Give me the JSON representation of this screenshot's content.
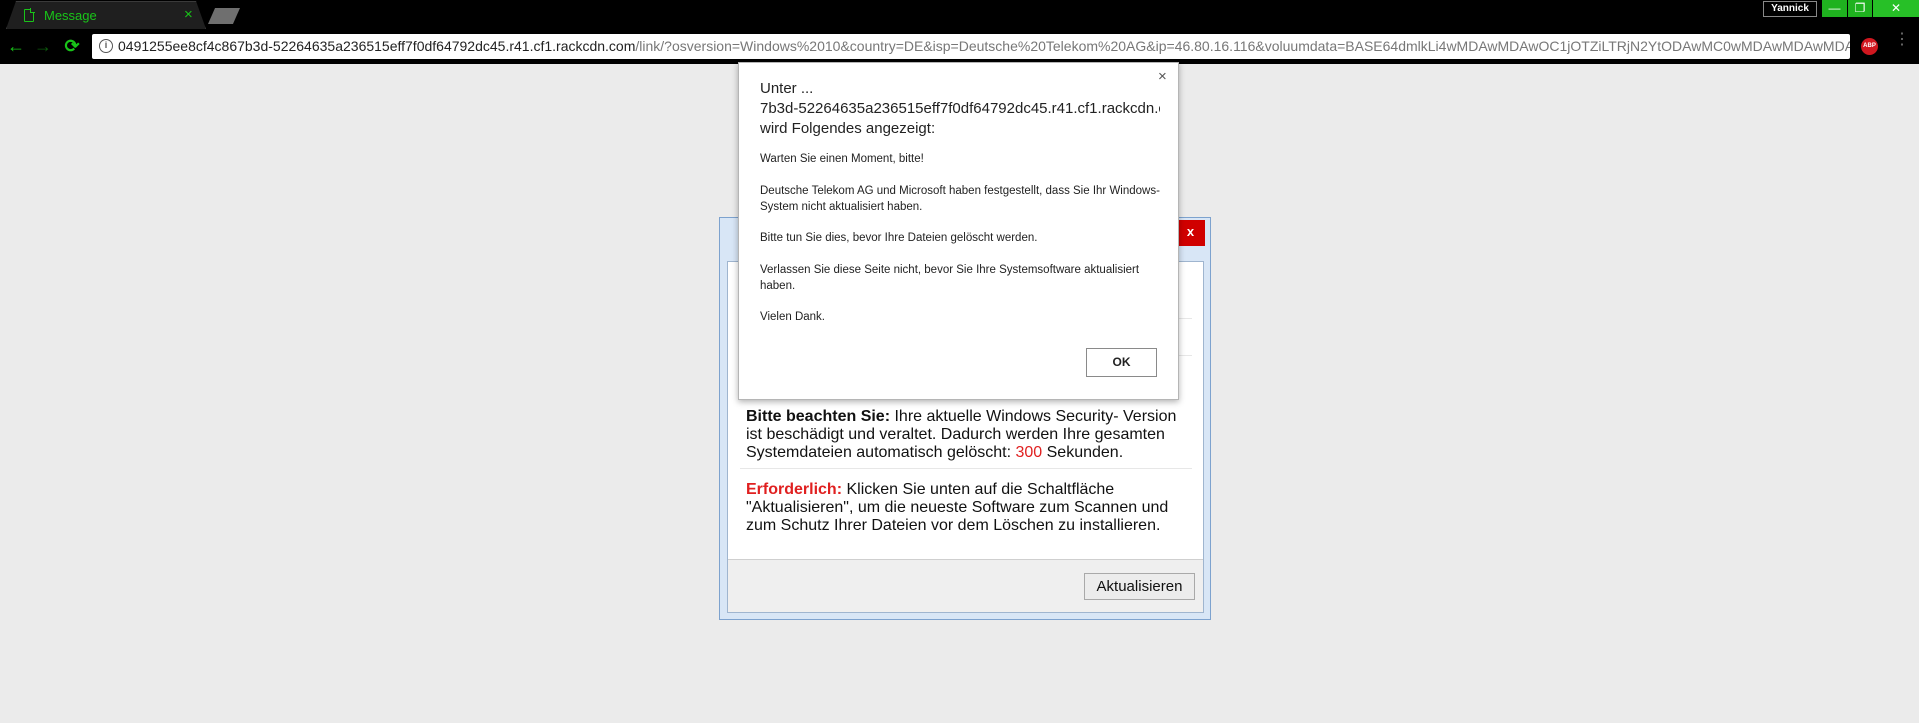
{
  "browser": {
    "tab": {
      "title": "Message",
      "close": "×"
    },
    "profile": "Yannick",
    "window_controls": {
      "minimize": "—",
      "restore": "❐",
      "close": "✕"
    },
    "nav": {
      "back": "←",
      "forward": "→",
      "reload": "⟳"
    },
    "address": {
      "host": "0491255ee8cf4c867b3d-52264635a236515eff7f0df64792dc45.r41.cf1.rackcdn.com",
      "path": "/link/?osversion=Windows%2010&country=DE&isp=Deutsche%20Telekom%20AG&ip=46.80.16.116&voluumdata=BASE64dmlkLi4wMDAwMDAwOC1jOTZiLTRjN2YtODAwMC0wMDAwMDAwMDA"
    },
    "star": "☆",
    "abp": "ABP",
    "menu": "⋮",
    "colors": {
      "accent": "#19c419",
      "chrome_bg": "#000000"
    }
  },
  "panel": {
    "close_label": "x",
    "notice_heading": "Bitte beachten Sie:",
    "notice_text_before": " Ihre aktuelle Windows Security- Version ist beschädigt und veraltet. Dadurch werden Ihre gesamten Systemdateien automatisch gelöscht: ",
    "countdown": "300",
    "notice_text_after": " Sekunden.",
    "required_heading": "Erforderlich:",
    "required_text": " Klicken Sie unten auf die Schaltfläche \"Aktualisieren\", um die neueste Software zum Scannen und zum Schutz Ihrer Dateien vor dem Löschen zu installieren.",
    "update_button": "Aktualisieren"
  },
  "alert": {
    "close_label": "×",
    "heading_line1": "Unter ...",
    "heading_line2": "7b3d-52264635a236515eff7f0df64792dc45.r41.cf1.rackcdn.c",
    "heading_line3": "wird Folgendes angezeigt:",
    "messages": [
      "Warten Sie einen Moment, bitte!",
      "Deutsche Telekom AG und Microsoft haben festgestellt, dass Sie Ihr Windows-System nicht aktualisiert haben.",
      "Bitte tun Sie dies, bevor Ihre Dateien gelöscht werden.",
      "Verlassen Sie diese Seite nicht, bevor Sie Ihre Systemsoftware aktualisiert haben.",
      "Vielen Dank."
    ],
    "ok_label": "OK"
  }
}
